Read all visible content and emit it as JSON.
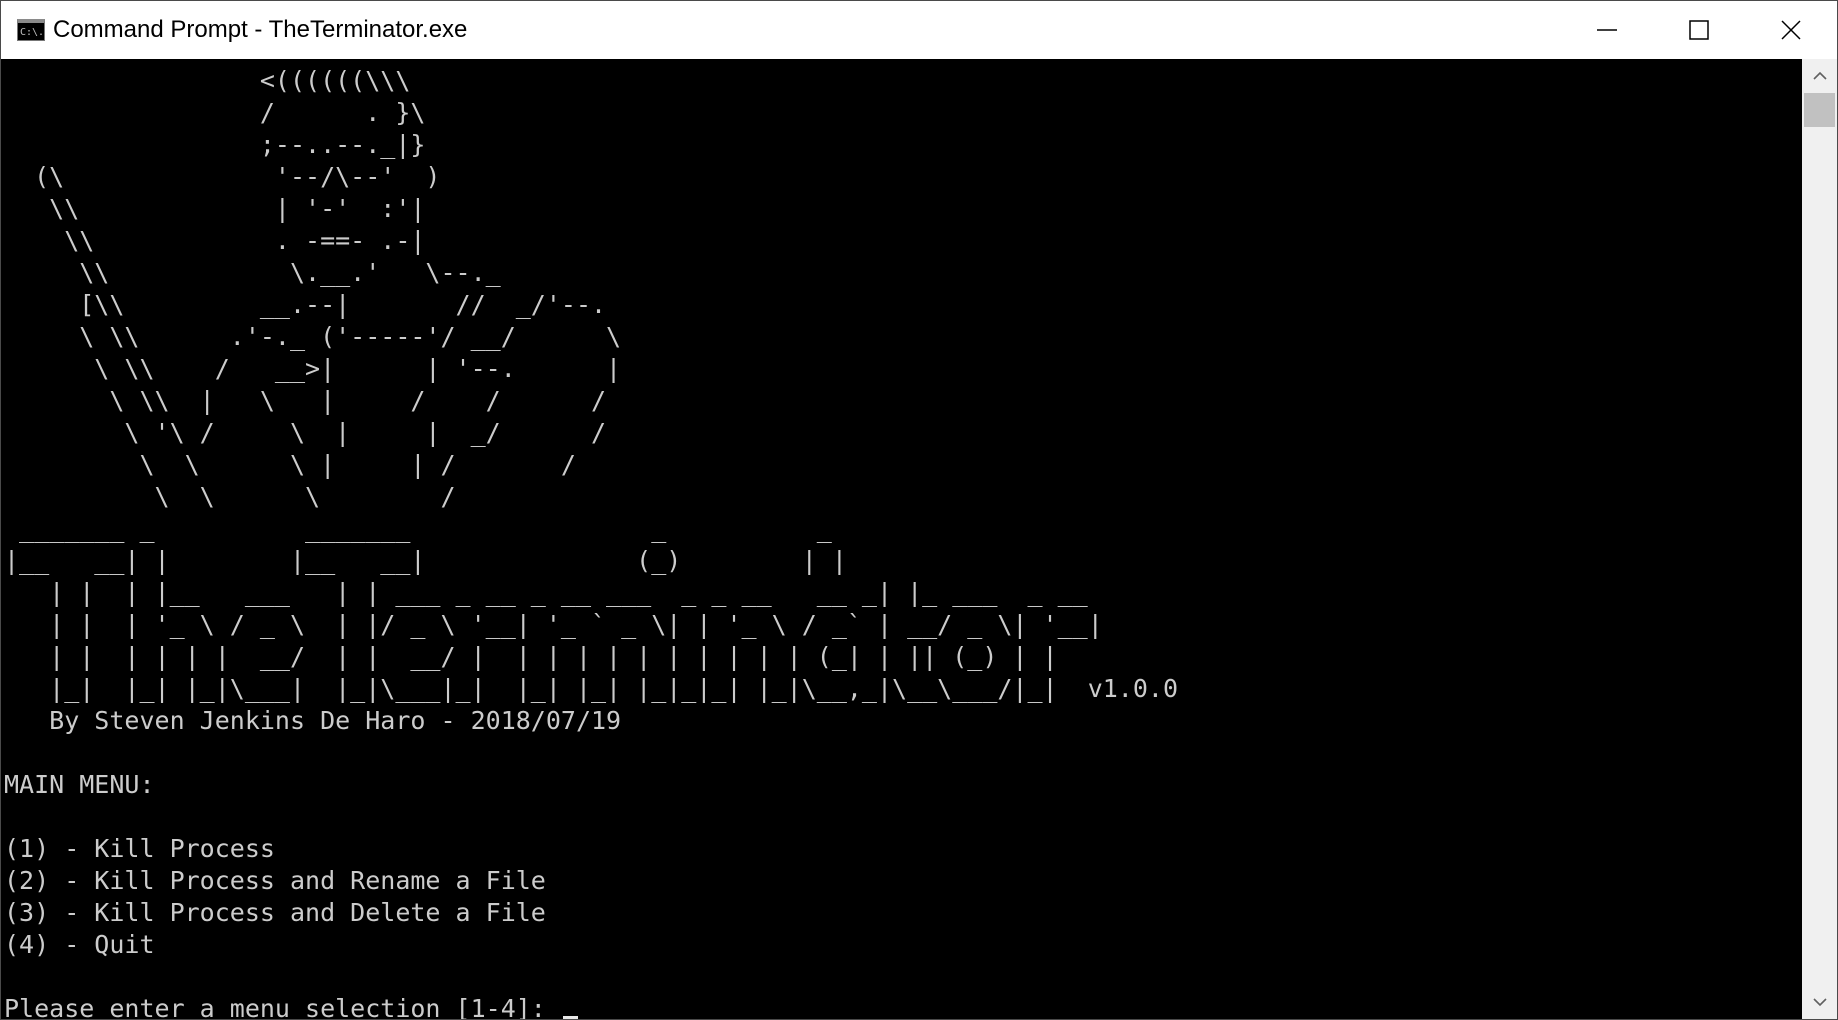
{
  "window": {
    "title": "Command Prompt - TheTerminator.exe",
    "app_icon": "command-prompt-icon",
    "app_icon_text": "C:\\.",
    "controls": [
      "minimize-icon",
      "maximize-icon",
      "close-icon"
    ]
  },
  "console": {
    "lines": [
      "                 <((((((\\\\\\",
      "                 /      . }\\",
      "                 ;--..--._|}",
      "  (\\              '--/\\--'  )",
      "   \\\\             | '-'  :'|",
      "    \\\\            . -==- .-|",
      "     \\\\            \\.__.'   \\--._",
      "     [\\\\         __.--|       //  _/'--.",
      "     \\ \\\\      .'-._ ('-----'/ __/      \\",
      "      \\ \\\\    /   __>|      | '--.      |",
      "       \\ \\\\  |   \\   |     /    /      /",
      "        \\ '\\ /     \\  |     |  _/      /",
      "         \\  \\      \\ |     | /       /",
      "          \\  \\      \\        /",
      " _______ _          _______                _          _",
      "|__   __| |        |__   __|              (_)        | |",
      "   | |  | |__   ___   | | ___ _ __ _ __ ___  _ _ __   __ _| |_ ___  _ __",
      "   | |  | '_ \\ / _ \\  | |/ _ \\ '__| '_ ` _ \\| | '_ \\ / _` | __/ _ \\| '__|",
      "   | |  | | | |  __/  | |  __/ |  | | | | | | | | | | (_| | || (_) | |",
      "   |_|  |_| |_|\\___|  |_|\\___|_|  |_| |_| |_|_|_| |_|\\__,_|\\__\\___/|_|  v1.0.0",
      "   By Steven Jenkins De Haro - 2018/07/19",
      "",
      "MAIN MENU:",
      "",
      "(1) - Kill Process",
      "(2) - Kill Process and Rename a File",
      "(3) - Kill Process and Delete a File",
      "(4) - Quit",
      ""
    ],
    "prompt": "Please enter a menu selection [1-4]: "
  },
  "scrollbar": {
    "up_icon": "scroll-up-arrow-icon",
    "down_icon": "scroll-down-arrow-icon"
  }
}
